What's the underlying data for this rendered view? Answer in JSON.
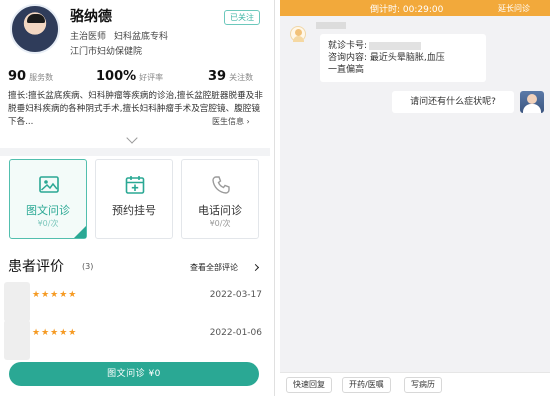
{
  "doctor": {
    "name": "骆纳德",
    "follow_status": "已关注",
    "title": "主治医师",
    "department": "妇科盆底专科",
    "hospital": "江门市妇幼保健院",
    "stats": [
      {
        "value": "90",
        "label": "服务数"
      },
      {
        "value": "100%",
        "label": "好评率"
      },
      {
        "value": "39",
        "label": "关注数"
      }
    ],
    "specialty": "擅长:擅长盆底疾病、妇科肿瘤等疾病的诊治,擅长盆腔脏器脱垂及非脱垂妇科疾病的各种阴式手术,擅长妇科肿瘤手术及宫腔镜、腹腔镜下各...",
    "more_info_label": "医生信息 ›"
  },
  "services": [
    {
      "name": "图文问诊",
      "price": "¥0/次",
      "icon": "image-icon",
      "active": true
    },
    {
      "name": "预约挂号",
      "price": "",
      "icon": "calendar-plus-icon",
      "active": false
    },
    {
      "name": "电话问诊",
      "price": "¥0/次",
      "icon": "phone-icon",
      "active": false
    }
  ],
  "reviews": {
    "title": "患者评价",
    "count": "(3)",
    "see_all_label": "查看全部评论",
    "items": [
      {
        "stars": "★★★★★",
        "date": "2022-03-17"
      },
      {
        "stars": "★★★★★",
        "date": "2022-01-06"
      }
    ]
  },
  "consult_button": "图文问诊  ¥0",
  "chat": {
    "timer_label": "倒计时:  00:29:00",
    "extend_label": "延长问诊",
    "patient_message": {
      "card_label": "就诊卡号:",
      "content_line1": "咨询内容: 最近头晕脑胀,血压",
      "content_line2": "一直偏高"
    },
    "doctor_message": "请问还有什么症状呢?",
    "quick_actions": [
      "快速回复",
      "开药/医嘱",
      "写病历"
    ]
  },
  "colors": {
    "primary": "#2aa894",
    "timer_bar": "#f2a93b",
    "star": "#f59a23"
  }
}
